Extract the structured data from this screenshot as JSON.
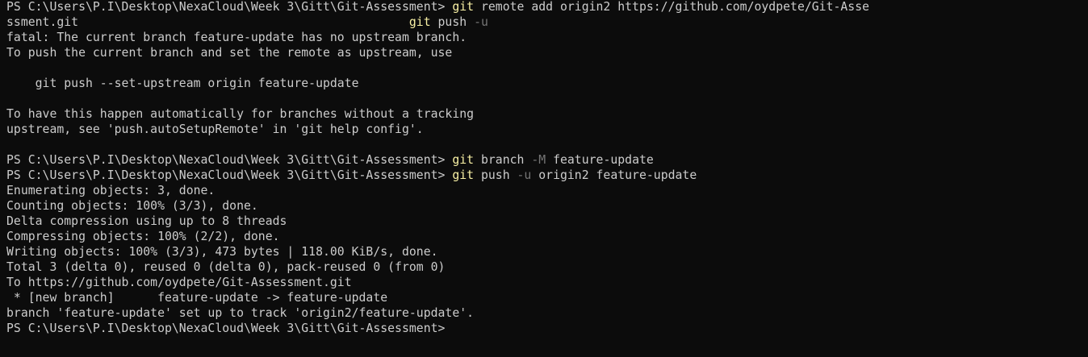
{
  "colors": {
    "background": "#0c0c0c",
    "text": "#cccccc",
    "command": "#f9f1a5",
    "flag": "#767676"
  },
  "prompt": "PS C:\\Users\\P.I\\Desktop\\NexaCloud\\Week 3\\Gitt\\Git-Assessment> ",
  "lines": [
    [
      {
        "t": "PS C:\\Users\\P.I\\Desktop\\NexaCloud\\Week 3\\Gitt\\Git-Assessment> "
      },
      {
        "t": "git",
        "c": "cmd"
      },
      {
        "t": " remote add origin2 https://github.com/oydpete/Git-Asse"
      }
    ],
    [
      {
        "t": "ssment.git                                              "
      },
      {
        "t": "git",
        "c": "cmd"
      },
      {
        "t": " push "
      },
      {
        "t": "-u",
        "c": "flag"
      }
    ],
    [
      {
        "t": "fatal: The current branch feature-update has no upstream branch."
      }
    ],
    [
      {
        "t": "To push the current branch and set the remote as upstream, use"
      }
    ],
    [
      {
        "t": ""
      }
    ],
    [
      {
        "t": "    git push --set-upstream origin feature-update"
      }
    ],
    [
      {
        "t": ""
      }
    ],
    [
      {
        "t": "To have this happen automatically for branches without a tracking"
      }
    ],
    [
      {
        "t": "upstream, see 'push.autoSetupRemote' in 'git help config'."
      }
    ],
    [
      {
        "t": ""
      }
    ],
    [
      {
        "t": "PS C:\\Users\\P.I\\Desktop\\NexaCloud\\Week 3\\Gitt\\Git-Assessment> "
      },
      {
        "t": "git",
        "c": "cmd"
      },
      {
        "t": " branch "
      },
      {
        "t": "-M",
        "c": "flag"
      },
      {
        "t": " feature-update"
      }
    ],
    [
      {
        "t": "PS C:\\Users\\P.I\\Desktop\\NexaCloud\\Week 3\\Gitt\\Git-Assessment> "
      },
      {
        "t": "git",
        "c": "cmd"
      },
      {
        "t": " push "
      },
      {
        "t": "-u",
        "c": "flag"
      },
      {
        "t": " origin2 feature-update"
      }
    ],
    [
      {
        "t": "Enumerating objects: 3, done."
      }
    ],
    [
      {
        "t": "Counting objects: 100% (3/3), done."
      }
    ],
    [
      {
        "t": "Delta compression using up to 8 threads"
      }
    ],
    [
      {
        "t": "Compressing objects: 100% (2/2), done."
      }
    ],
    [
      {
        "t": "Writing objects: 100% (3/3), 473 bytes | 118.00 KiB/s, done."
      }
    ],
    [
      {
        "t": "Total 3 (delta 0), reused 0 (delta 0), pack-reused 0 (from 0)"
      }
    ],
    [
      {
        "t": "To https://github.com/oydpete/Git-Assessment.git"
      }
    ],
    [
      {
        "t": " * [new branch]      feature-update -> feature-update"
      }
    ],
    [
      {
        "t": "branch 'feature-update' set up to track 'origin2/feature-update'."
      }
    ],
    [
      {
        "t": "PS C:\\Users\\P.I\\Desktop\\NexaCloud\\Week 3\\Gitt\\Git-Assessment>"
      }
    ]
  ]
}
